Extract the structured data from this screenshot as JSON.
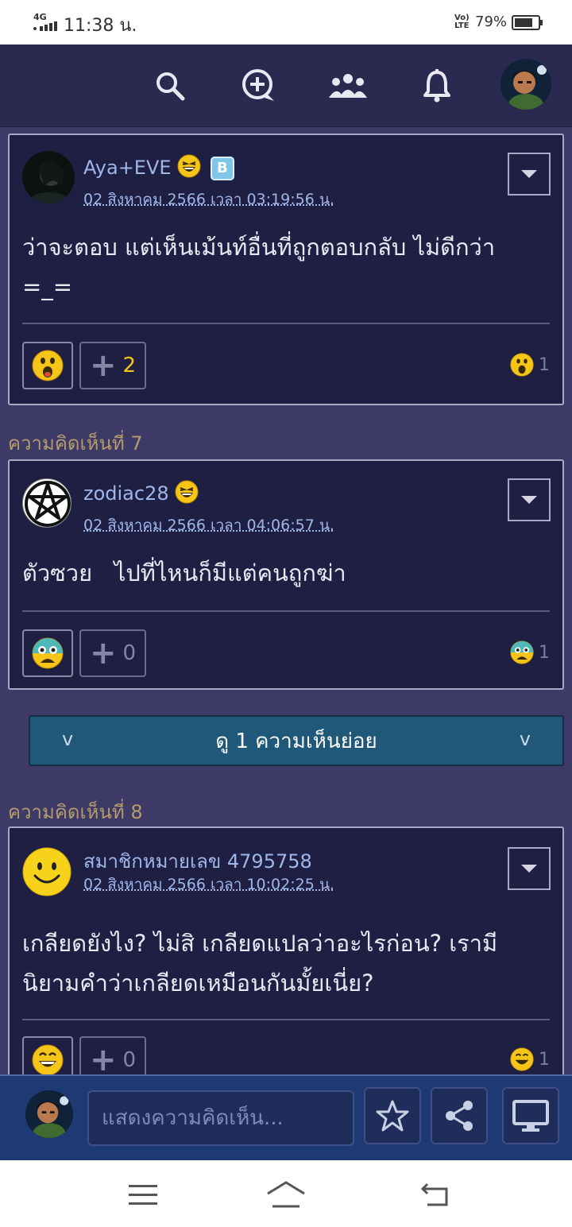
{
  "status_bar": {
    "network": "4G",
    "time": "11:38 น.",
    "volte": "Vo) LTE",
    "battery_percent": "79%",
    "battery_level": 0.79
  },
  "top_nav": {
    "icons": [
      "search-icon",
      "new-topic-icon",
      "community-icon",
      "bell-icon",
      "profile-avatar"
    ]
  },
  "comments": [
    {
      "username": "Aya+EVE",
      "badge_emoji": "laughing-face",
      "member_badge": "B",
      "timestamp": "02 สิงหาคม 2566 เวลา 03:19:56 น.",
      "body": "ว่าจะตอบ แต่เห็นเม้นท์อื่นที่ถูกตอบกลับ ไม่ดีกว่า =_=",
      "reaction": "surprised-face",
      "plus_count": "2",
      "reaction_count": "1"
    },
    {
      "label": "ความคิดเห็นที่ 7",
      "username": "zodiac28",
      "badge_emoji": "laughing-face",
      "timestamp": "02 สิงหาคม 2566 เวลา 04:06:57 น.",
      "body": "ตัวซวย   ไปที่ไหนก็มีแต่คนถูกฆ่า",
      "reaction": "scared-face",
      "plus_count": "0",
      "reaction_count": "1"
    },
    {
      "label": "ความคิดเห็นที่ 8",
      "username": "สมาชิกหมายเลข 4795758",
      "timestamp": "02 สิงหาคม 2566 เวลา 10:02:25 น.",
      "body": "เกลียดยังไง? ไม่สิ เกลียดแปลว่าอะไรก่อน? เรามีนิยามคำว่าเกลียดเหมือนกันมั้ยเนี่ย?",
      "reaction": "grinning-face",
      "plus_count": "0",
      "reaction_count": "1"
    }
  ],
  "reply_toggle": {
    "label": "ดู 1 ความเห็นย่อย",
    "chevron": "v"
  },
  "comment_bar": {
    "placeholder": "แสดงความคิดเห็น..."
  },
  "colors": {
    "background": "#3d3a68",
    "card": "#1f1f44",
    "username": "#9fb6e8",
    "section_label": "#b59a6a",
    "reply_toggle": "#1f5878",
    "comment_bar": "#1d3a74"
  }
}
